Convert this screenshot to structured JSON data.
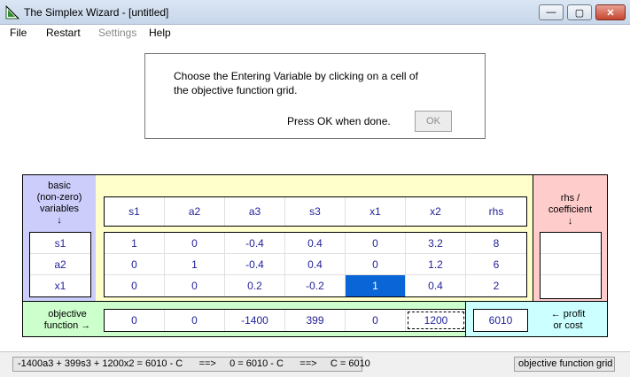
{
  "window": {
    "title": "The Simplex Wizard - [untitled]",
    "minimize": "—",
    "maximize": "▢",
    "close": "✕"
  },
  "menu": [
    "File",
    "Restart",
    "Settings",
    "Help"
  ],
  "instructions": {
    "line1": "Choose the Entering Variable  by clicking on a cell of",
    "line2": "the objective function grid.",
    "press": "Press OK when done.",
    "ok_label": "OK"
  },
  "labels": {
    "basic": [
      "basic",
      "(non-zero)",
      "variables",
      "↓"
    ],
    "rhs": [
      "rhs /",
      "coefficient",
      "↓"
    ],
    "objective": [
      "objective",
      "function  →"
    ],
    "profit": [
      "←  profit",
      "or cost"
    ]
  },
  "headers": [
    "s1",
    "a2",
    "a3",
    "s3",
    "x1",
    "x2",
    "rhs"
  ],
  "basic_vars": [
    "s1",
    "a2",
    "x1"
  ],
  "rows": [
    [
      "1",
      "0",
      "-0.4",
      "0.4",
      "0",
      "3.2",
      "8"
    ],
    [
      "0",
      "1",
      "-0.4",
      "0.4",
      "0",
      "1.2",
      "6"
    ],
    [
      "0",
      "0",
      "0.2",
      "-0.2",
      "1",
      "0.4",
      "2"
    ]
  ],
  "objective_row": [
    "0",
    "0",
    "-1400",
    "399",
    "0",
    "1200"
  ],
  "objective_value": "6010",
  "status": {
    "left": "-1400a3 + 399s3 + 1200x2 = 6010 - C      ==>     0 = 6010 - C      ==>     C = 6010",
    "right": "objective function grid"
  }
}
